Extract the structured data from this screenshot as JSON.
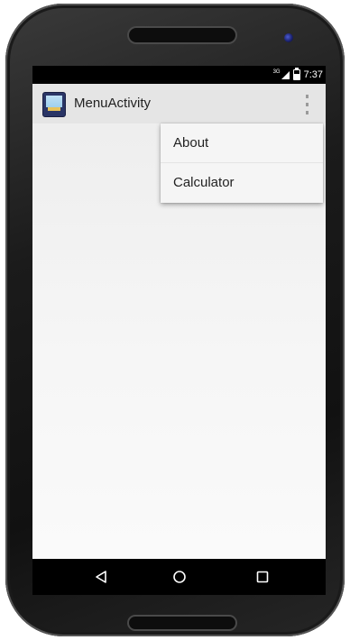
{
  "status_bar": {
    "network": "3G",
    "time": "7:37"
  },
  "action_bar": {
    "title": "MenuActivity"
  },
  "overflow_menu": {
    "items": [
      {
        "label": "About"
      },
      {
        "label": "Calculator"
      }
    ]
  },
  "navigation": {
    "back_icon": "back-triangle-icon",
    "home_icon": "home-circle-icon",
    "recent_icon": "recent-apps-square-icon"
  },
  "colors": {
    "action_bar": "#e5e5e5",
    "menu_background": "#f5f5f5",
    "status_bar": "#000000",
    "nav_bar": "#000000"
  }
}
